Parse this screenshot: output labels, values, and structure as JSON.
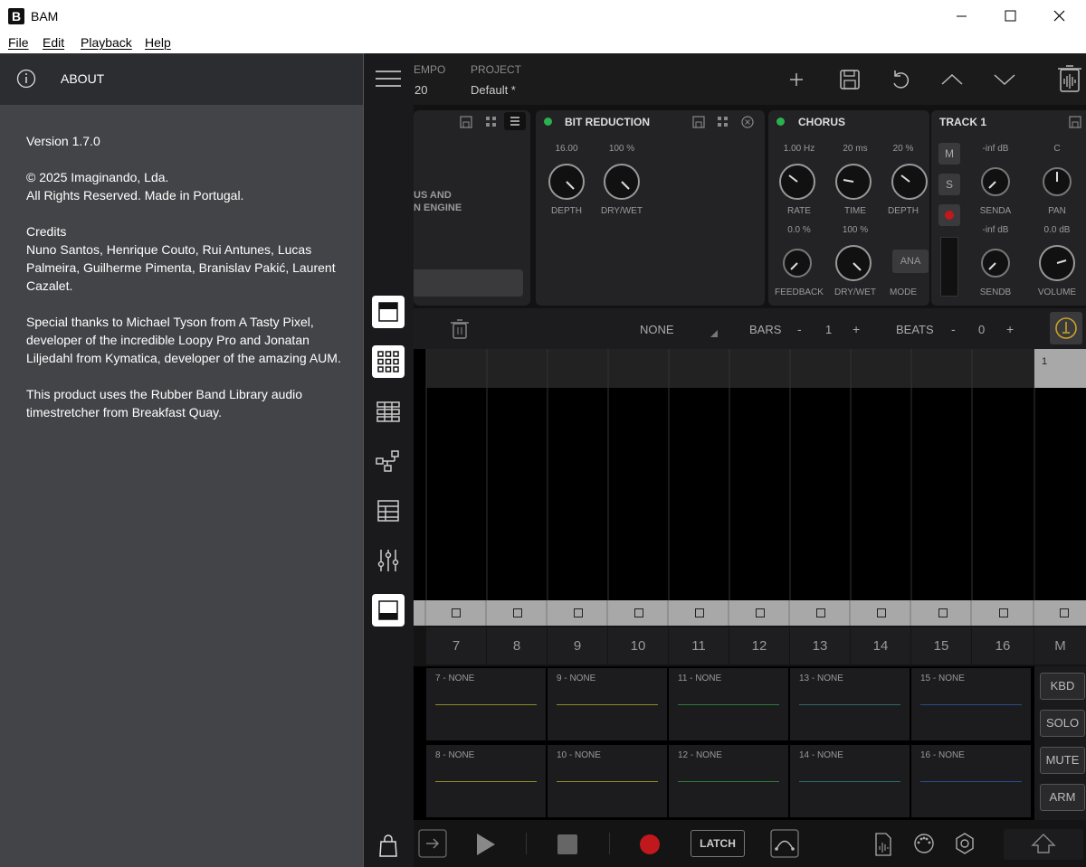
{
  "window": {
    "title": "BAM"
  },
  "menu": [
    "File",
    "Edit",
    "Playback",
    "Help"
  ],
  "about": {
    "title": "ABOUT",
    "version": "Version 1.7.0",
    "copyright1": "© 2025 Imaginando, Lda.",
    "copyright2": "All Rights Reserved. Made in Portugal.",
    "credits_title": "Credits",
    "credits": "Nuno Santos, Henrique Couto, Rui Antunes, Lucas Palmeira, Guilherme Pimenta, Branislav Pakić, Laurent Cazalet.",
    "thanks": "Special thanks to Michael Tyson from A Tasty Pixel, developer of the incredible Loopy Pro and Jonatan Liljedahl from Kymatica, developer of the amazing AUM.",
    "rubberband": "This product uses the Rubber Band Library audio timestretcher from Breakfast Quay."
  },
  "topbar": {
    "tempo_label": "EMPO",
    "tempo_value": "20",
    "project_label": "PROJECT",
    "project_value": "Default *"
  },
  "fx": {
    "partial_text1": "US AND",
    "partial_text2": "N ENGINE",
    "bitreduction": {
      "title": "BIT REDUCTION",
      "depth_val": "16.00",
      "drywet_val": "100 %",
      "depth_lbl": "DEPTH",
      "drywet_lbl": "DRY/WET"
    },
    "chorus": {
      "title": "CHORUS",
      "rate_val": "1.00 Hz",
      "time_val": "20 ms",
      "depth_val": "20 %",
      "rate_lbl": "RATE",
      "time_lbl": "TIME",
      "depth_lbl": "DEPTH",
      "feedback_val": "0.0 %",
      "drywet_val": "100 %",
      "feedback_lbl": "FEEDBACK",
      "drywet_lbl": "DRY/WET",
      "mode_btn": "ANA",
      "mode_lbl": "MODE"
    },
    "track": {
      "title": "TRACK 1",
      "m": "M",
      "s": "S",
      "senda_val": "-inf dB",
      "pan_val": "C",
      "senda_lbl": "SENDA",
      "pan_lbl": "PAN",
      "sendb_val": "-inf dB",
      "volume_val": "0.0 dB",
      "sendb_lbl": "SENDB",
      "volume_lbl": "VOLUME"
    }
  },
  "seqbar": {
    "pattern": "NONE",
    "bars_lbl": "BARS",
    "bars_minus": "-",
    "bars_val": "1",
    "bars_plus": "+",
    "beats_lbl": "BEATS",
    "beats_minus": "-",
    "beats_val": "0",
    "beats_plus": "+"
  },
  "grid": {
    "first_cell": "1"
  },
  "tracks": [
    "7",
    "8",
    "9",
    "10",
    "11",
    "12",
    "13",
    "14",
    "15",
    "16",
    "M"
  ],
  "clips_row1": [
    "7 - NONE",
    "9 - NONE",
    "11 - NONE",
    "13 - NONE",
    "15 - NONE"
  ],
  "clips_row2": [
    "8 - NONE",
    "10 - NONE",
    "12 - NONE",
    "14 - NONE",
    "16 - NONE"
  ],
  "side_buttons": [
    "KBD",
    "SOLO",
    "MUTE",
    "ARM"
  ],
  "transport": {
    "latch": "LATCH"
  },
  "colors": {
    "accent_green": "#2bb24c",
    "record_red": "#c0181c",
    "tempo_gold": "#c9a227"
  }
}
